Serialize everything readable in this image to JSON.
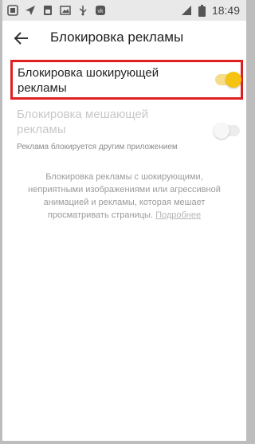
{
  "status_bar": {
    "time": "18:49",
    "icons_left": [
      "notification-icon",
      "send-icon",
      "sim-icon",
      "image-icon",
      "usb-icon",
      "vk-icon"
    ],
    "icons_right": [
      "signal-icon",
      "battery-icon"
    ]
  },
  "header": {
    "title": "Блокировка рекламы",
    "back_icon": "arrow-left-icon"
  },
  "settings": {
    "shocking_ads": {
      "label": "Блокировка шокирующей рекламы",
      "enabled": true
    },
    "annoying_ads": {
      "label": "Блокировка мешающей рекламы",
      "enabled": false,
      "disabled": true,
      "subtitle": "Реклама блокируется другим приложением"
    }
  },
  "description": {
    "text": "Блокировка рекламы с шокирующими, неприятными изображениями или агрессивной анимацией и рекламы, которая мешает просматривать страницы.",
    "link_label": "Подробнее"
  },
  "colors": {
    "accent": "#f6c311",
    "highlight_border": "#e02020"
  }
}
